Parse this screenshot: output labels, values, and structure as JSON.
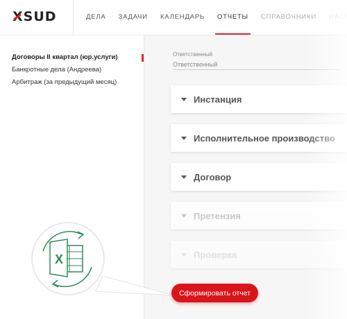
{
  "brand": {
    "logo_prefix": "X",
    "logo_rest": "SUD"
  },
  "nav": [
    {
      "label": "ДЕЛА"
    },
    {
      "label": "ЗАДАЧИ"
    },
    {
      "label": "КАЛЕНДАРЬ"
    },
    {
      "label": "ОТЧЕТЫ",
      "active": true
    },
    {
      "label": "СПРАВОЧНИКИ"
    },
    {
      "label": "НАСТРОЙ"
    }
  ],
  "reports": [
    {
      "label": "Договоры II квартал (юр.услуги)",
      "active": true
    },
    {
      "label": "Банкротные дела (Андреева)"
    },
    {
      "label": "Арбитраж (за предыдущий месяц)"
    }
  ],
  "filter": {
    "label": "Ответственный",
    "placeholder": "Ответственный"
  },
  "sections": [
    {
      "label": "Инстанция"
    },
    {
      "label": "Исполнительное производство"
    },
    {
      "label": "Договор"
    },
    {
      "label": "Претензия"
    },
    {
      "label": "Проверка"
    }
  ],
  "action": {
    "label": "Сформировать отчет"
  },
  "excel_icon": {
    "letter": "X",
    "accent": "#2e8b57"
  },
  "colors": {
    "accent": "#e0262c",
    "button": "#d9151b"
  }
}
